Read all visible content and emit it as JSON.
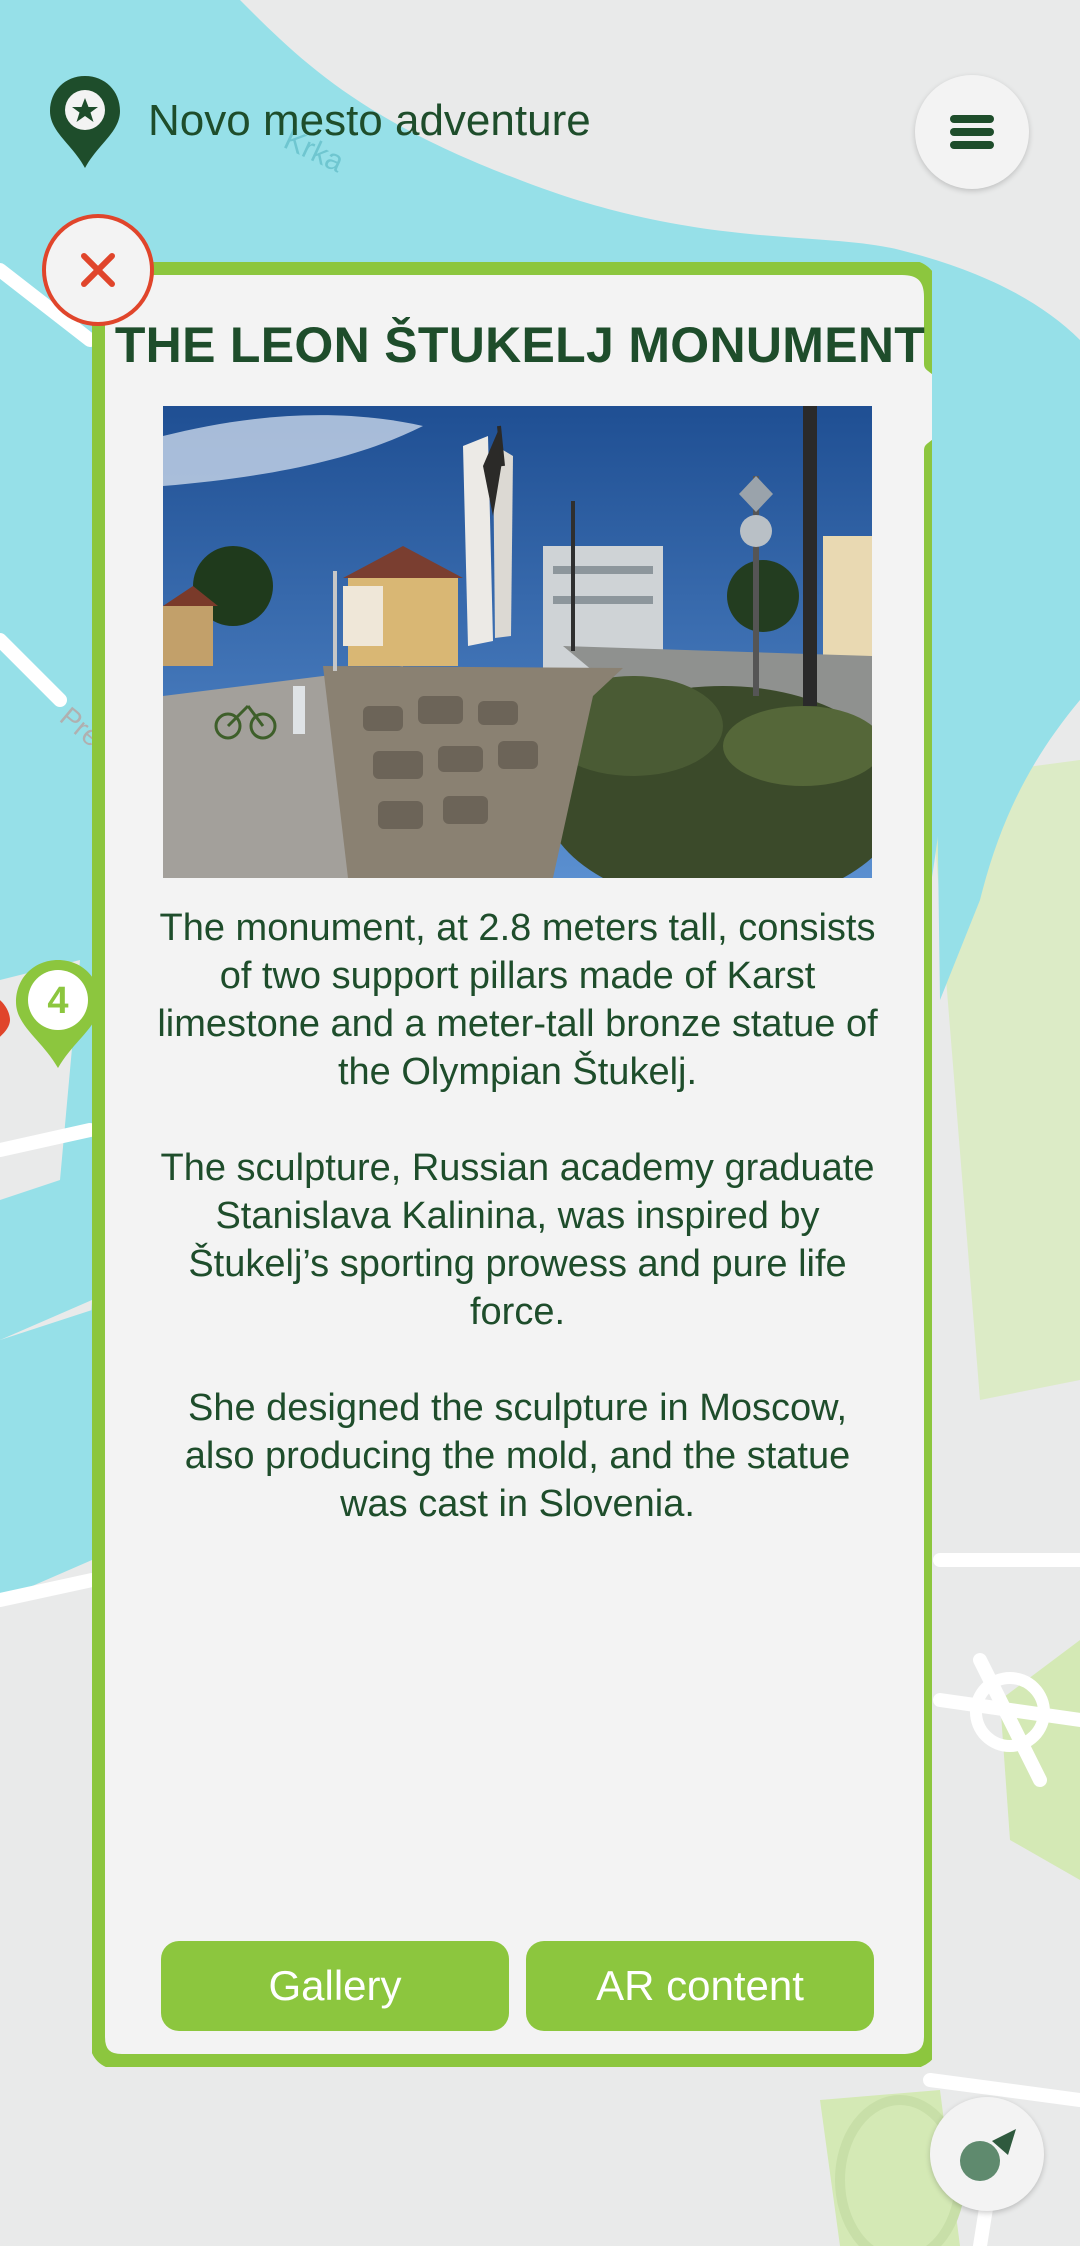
{
  "header": {
    "app_title": "Novo mesto adventure",
    "logo_icon": "map-pin-star-icon",
    "menu_icon": "hamburger-menu-icon"
  },
  "map": {
    "labels": [
      "Krka",
      "Pre"
    ],
    "marker_number": "4"
  },
  "popup": {
    "title": "THE LEON ŠTUKELJ MONUMENT",
    "close_icon": "close-icon",
    "paragraphs": [
      "The monument, at 2.8 meters tall, consists of two support pillars made of Karst limestone and a meter-tall bronze statue of the Olympian Štukelj.",
      "The sculpture, Russian academy graduate Stanislava Kalinina, was inspired by Štukelj’s sporting prowess and pure life force.",
      "She designed the sculpture in Moscow, also producing the mold, and the statue was cast in Slovenia."
    ],
    "buttons": {
      "gallery": "Gallery",
      "ar_content": "AR content"
    }
  },
  "colors": {
    "accent_green": "#8cc63e",
    "dark_green": "#1e4d2b",
    "close_red": "#e0452b",
    "water": "#96e0e8",
    "panel_bg": "#f3f3f3"
  }
}
